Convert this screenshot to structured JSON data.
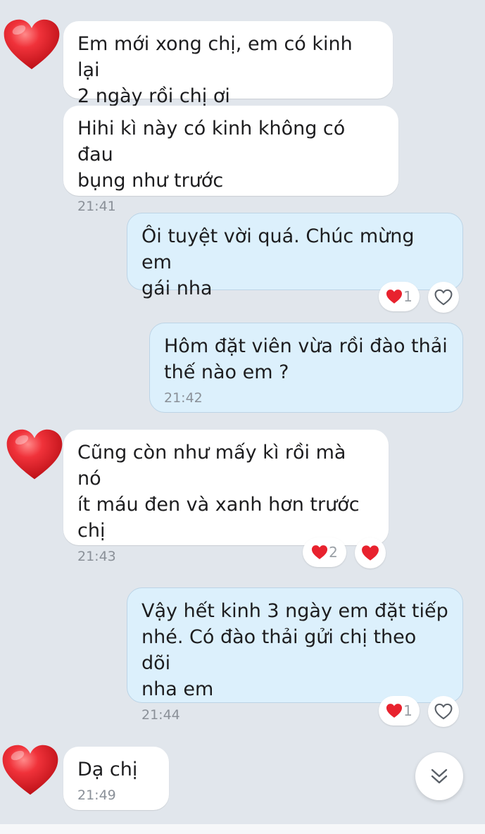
{
  "messages": [
    {
      "direction": "incoming",
      "text": "Em mới xong chị, em có kinh lại\n2 ngày rồi chị ơi",
      "time": ""
    },
    {
      "direction": "incoming",
      "text": "Hihi kì này có kinh không có đau\nbụng như trước",
      "time": "21:41"
    },
    {
      "direction": "outgoing",
      "text": "Ôi tuyệt vời quá. Chúc mừng em\ngái nha",
      "time": "",
      "reaction_count": "1"
    },
    {
      "direction": "outgoing",
      "text": "Hôm đặt viên vừa rồi đào thải\nthế nào em ?",
      "time": "21:42"
    },
    {
      "direction": "incoming",
      "text": "Cũng còn như mấy kì rồi mà nó\nít máu đen và xanh hơn trước\nchị",
      "time": "21:43",
      "reaction_count": "2"
    },
    {
      "direction": "outgoing",
      "text": "Vậy hết kinh 3 ngày em đặt tiếp\nnhé. Có đào thải gửi chị theo dõi\nnha em",
      "time": "21:44",
      "reaction_count": "1"
    },
    {
      "direction": "incoming",
      "text": "Dạ chị",
      "time": "21:49"
    }
  ],
  "avatar_icon": "heart-avatar-icon",
  "reaction_icon": "heart-icon",
  "like_icon": "heart-outline-icon",
  "scroll_icon": "double-chevron-down-icon",
  "colors": {
    "background": "#e1e6ec",
    "incoming_bubble": "#ffffff",
    "outgoing_bubble": "#dcf0fc",
    "heart": "#e8222e",
    "timestamp": "#8a9098"
  }
}
